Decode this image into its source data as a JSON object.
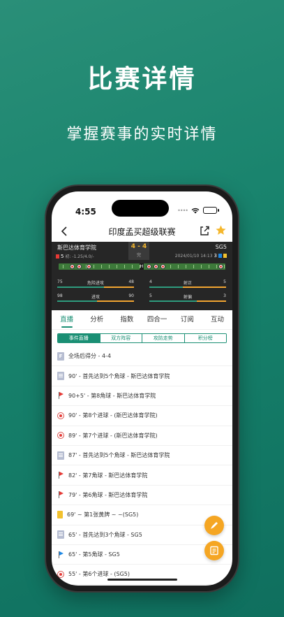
{
  "hero": {
    "title": "比赛详情",
    "subtitle": "掌握赛事的实时详情"
  },
  "status_bar": {
    "time": "4:55"
  },
  "nav": {
    "title": "印度孟买超级联赛"
  },
  "match": {
    "home_team": "斯巴达体育学院",
    "away_team": "SG5",
    "score": "4 - 4",
    "status": "完",
    "home_corners": "5",
    "odds": "初: -1.25/4.0/-",
    "datetime": "2024/01/10 14:13",
    "away_corners": "3",
    "away_yellow": "1",
    "away_extra": "5",
    "half_marker": "H",
    "stats": [
      {
        "label": "危险进攻",
        "left": "75",
        "right": "48",
        "home_share": 0.61
      },
      {
        "label": "射正",
        "left": "4",
        "right": "5",
        "home_share": 0.44
      },
      {
        "label": "进攻",
        "left": "98",
        "right": "90",
        "home_share": 0.52
      },
      {
        "label": "射偏",
        "left": "5",
        "right": "3",
        "home_share": 0.62
      }
    ]
  },
  "tabs": [
    {
      "label": "直播",
      "active": true
    },
    {
      "label": "分析",
      "active": false
    },
    {
      "label": "指数",
      "active": false
    },
    {
      "label": "四合一",
      "active": false
    },
    {
      "label": "订阅",
      "active": false
    },
    {
      "label": "互动",
      "active": false
    }
  ],
  "subtabs": [
    {
      "label": "事件直播",
      "active": true
    },
    {
      "label": "双方阵容",
      "active": false
    },
    {
      "label": "攻防走势",
      "active": false
    },
    {
      "label": "积分榜",
      "active": false
    }
  ],
  "events": [
    {
      "icon": "final-score-icon",
      "text": "全场后得分 - 4-4"
    },
    {
      "icon": "document-icon",
      "text": "90' - 首先达到5个角球 - 斯巴达体育学院"
    },
    {
      "icon": "corner-flag-red-icon",
      "text": "90+5' - 第8角球 - 斯巴达体育学院"
    },
    {
      "icon": "goal-ball-icon",
      "text": "90' - 第8个进球 -  (斯巴达体育学院)"
    },
    {
      "icon": "goal-ball-icon",
      "text": "89' - 第7个进球 -  (斯巴达体育学院)"
    },
    {
      "icon": "document-icon",
      "text": "87' - 首先达到5个角球 - 斯巴达体育学院"
    },
    {
      "icon": "corner-flag-red-icon",
      "text": "82' - 第7角球 - 斯巴达体育学院"
    },
    {
      "icon": "corner-flag-red-icon",
      "text": "79' - 第6角球 - 斯巴达体育学院"
    },
    {
      "icon": "yellow-card-icon",
      "text": "69' ~ 第1张黄牌 ~  ~(SG5)"
    },
    {
      "icon": "document-icon",
      "text": "65' - 首先达到3个角球 - SG5"
    },
    {
      "icon": "corner-flag-blue-icon",
      "text": "65' - 第5角球 - SG5"
    },
    {
      "icon": "goal-ball-icon",
      "text": "55' - 第6个进球 -  (SG5)"
    }
  ],
  "colors": {
    "brand": "#1a8f74",
    "accent": "#f5a623",
    "panel": "#262626"
  }
}
